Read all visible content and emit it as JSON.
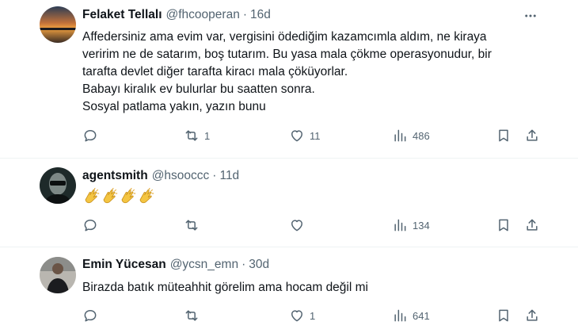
{
  "tweets": [
    {
      "author": "Felaket Tellalı",
      "handle": "@fhcooperan",
      "separator": "·",
      "time": "16d",
      "lines": [
        "Affedersiniz ama evim var, vergisini ödediğim kazamcımla aldım, ne kiraya",
        "veririm ne de satarım, boş tutarım. Bu yasa mala çökme operasyonudur, bir",
        "tarafta devlet diğer tarafta kiracı mala çöküyorlar.",
        "Babayı kiralık ev bulurlar bu saatten sonra.",
        "Sosyal patlama yakın, yazın bunu"
      ],
      "replies": "",
      "reposts": "1",
      "likes": "11",
      "views": "486"
    },
    {
      "author": "agentsmith",
      "handle": "@hsooccc",
      "separator": "·",
      "time": "11d",
      "emojis": [
        "clapping-hands",
        "clapping-hands",
        "clapping-hands",
        "clapping-hands"
      ],
      "replies": "",
      "reposts": "",
      "likes": "",
      "views": "134"
    },
    {
      "author": "Emin Yücesan",
      "handle": "@ycsn_emn",
      "separator": "·",
      "time": "30d",
      "lines": [
        "Birazda batık müteahhit görelim ama hocam değil mi"
      ],
      "replies": "",
      "reposts": "",
      "likes": "1",
      "views": "641"
    }
  ],
  "colors": {
    "text": "#0f1419",
    "secondary": "#536471",
    "divider": "#eff3f4",
    "clap": "#f4c542"
  },
  "icons": [
    "reply-icon",
    "repost-icon",
    "like-icon",
    "views-icon",
    "bookmark-icon",
    "share-icon",
    "more-icon"
  ]
}
